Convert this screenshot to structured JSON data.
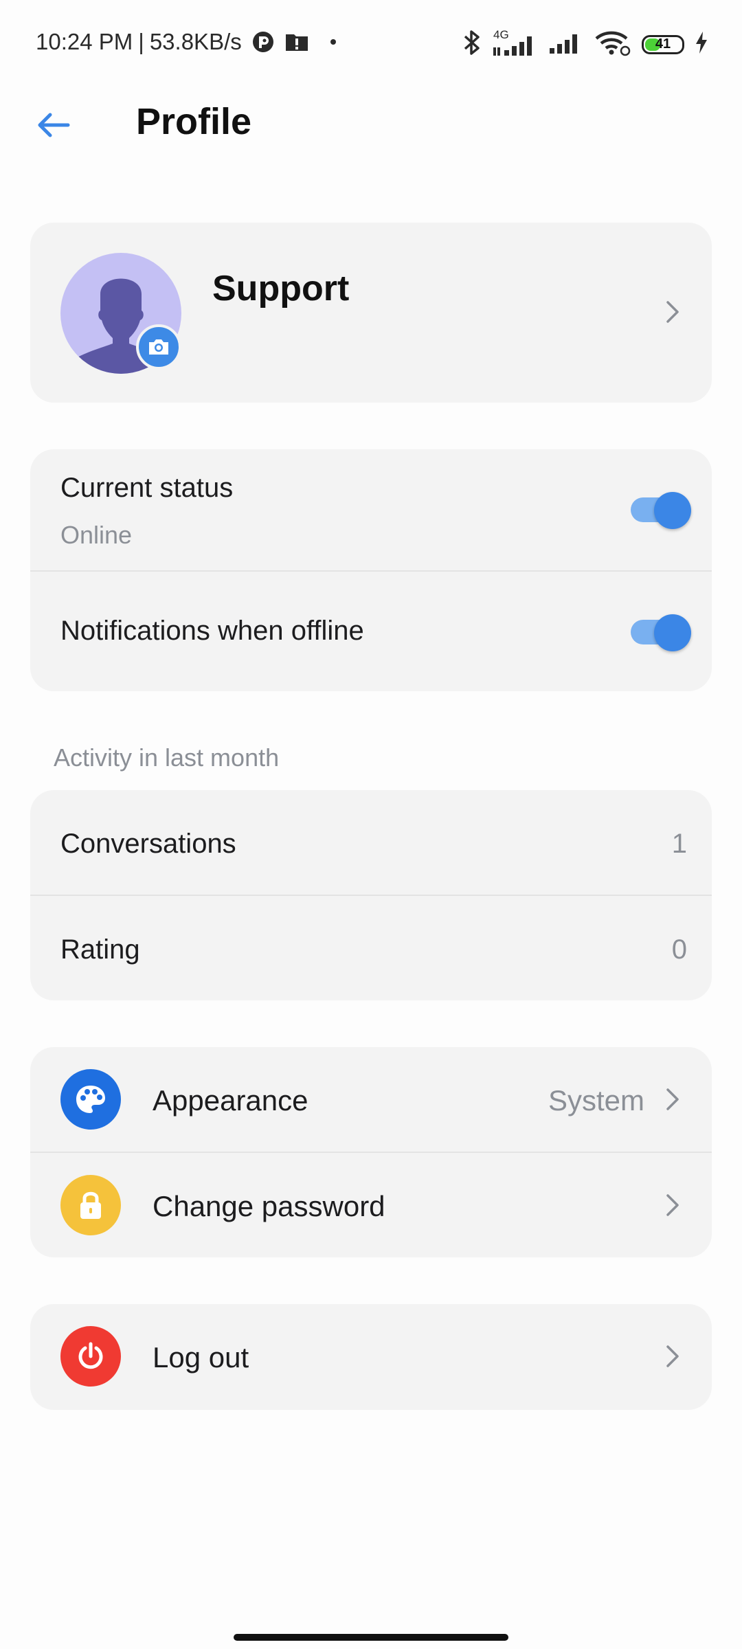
{
  "status_bar": {
    "time": "10:24 PM",
    "separator": "|",
    "net_speed": "53.8KB/s",
    "network_type": "4G",
    "battery_level": "41",
    "icons": [
      "app-notification-icon",
      "alert-icon",
      "dot-icon",
      "bluetooth-icon",
      "signal-icon",
      "signal-icon",
      "wifi-icon",
      "battery-icon",
      "charging-icon"
    ]
  },
  "header": {
    "title": "Profile",
    "back_icon": "arrow-left-icon"
  },
  "profile": {
    "name": "Support",
    "avatar_icon": "person-silhouette-icon",
    "camera_icon": "camera-icon"
  },
  "status": {
    "current_status_label": "Current status",
    "current_status_value": "Online",
    "current_status_on": true,
    "offline_notifications_label": "Notifications when offline",
    "offline_notifications_on": true
  },
  "activity": {
    "section_title": "Activity in last month",
    "rows": [
      {
        "label": "Conversations",
        "value": "1"
      },
      {
        "label": "Rating",
        "value": "0"
      }
    ]
  },
  "settings": {
    "appearance_label": "Appearance",
    "appearance_value": "System",
    "change_password_label": "Change password",
    "logout_label": "Log out"
  },
  "colors": {
    "accent": "#3b86e6",
    "appearance_icon_bg": "#1f6fe0",
    "password_icon_bg": "#f5c23b",
    "logout_icon_bg": "#f03a32",
    "avatar_bg": "#c4c0f4",
    "avatar_fg": "#5b57a4",
    "card_bg": "#f3f3f3"
  }
}
